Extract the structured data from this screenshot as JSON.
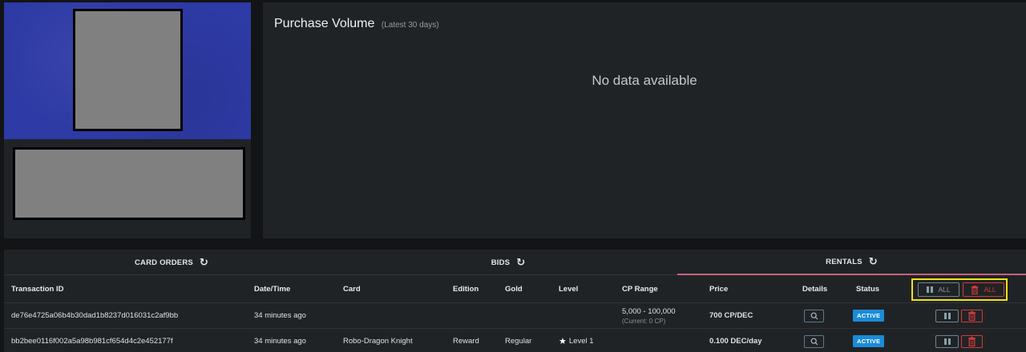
{
  "chart": {
    "title": "Purchase Volume",
    "subtitle": "(Latest 30 days)",
    "empty_message": "No data available"
  },
  "tabs": [
    {
      "label": "CARD ORDERS"
    },
    {
      "label": "BIDS"
    },
    {
      "label": "RENTALS"
    }
  ],
  "table": {
    "columns": [
      "Transaction ID",
      "Date/Time",
      "Card",
      "Edition",
      "Gold",
      "Level",
      "CP Range",
      "Price",
      "Details",
      "Status"
    ],
    "all_pause_label": "ALL",
    "all_cancel_label": "ALL",
    "rows": [
      {
        "transaction_id": "de76e4725a06b4b30dad1b8237d016031c2af9bb",
        "datetime": "34 minutes ago",
        "card": "",
        "edition": "",
        "gold": "",
        "level": "",
        "cp_range": "5,000 - 100,000",
        "cp_current": "(Current: 0 CP)",
        "price": "700 CP/DEC",
        "status": "ACTIVE"
      },
      {
        "transaction_id": "bb2bee0116f002a5a98b981cf654d4c2e452177f",
        "datetime": "34 minutes ago",
        "card": "Robo-Dragon Knight",
        "edition": "Reward",
        "gold": "Regular",
        "level": "Level 1",
        "cp_range": "",
        "cp_current": "",
        "price": "0.100 DEC/day",
        "status": "ACTIVE"
      }
    ]
  },
  "colors": {
    "accent_tab": "#c8637b",
    "status_active": "#1b8bd8",
    "danger": "#d23a3a",
    "highlight": "#f2e21a"
  },
  "icons": {
    "refresh": "refresh-icon",
    "details": "magnifier-icon",
    "pause": "pause-icon",
    "trash": "trash-icon",
    "star": "star-icon"
  }
}
